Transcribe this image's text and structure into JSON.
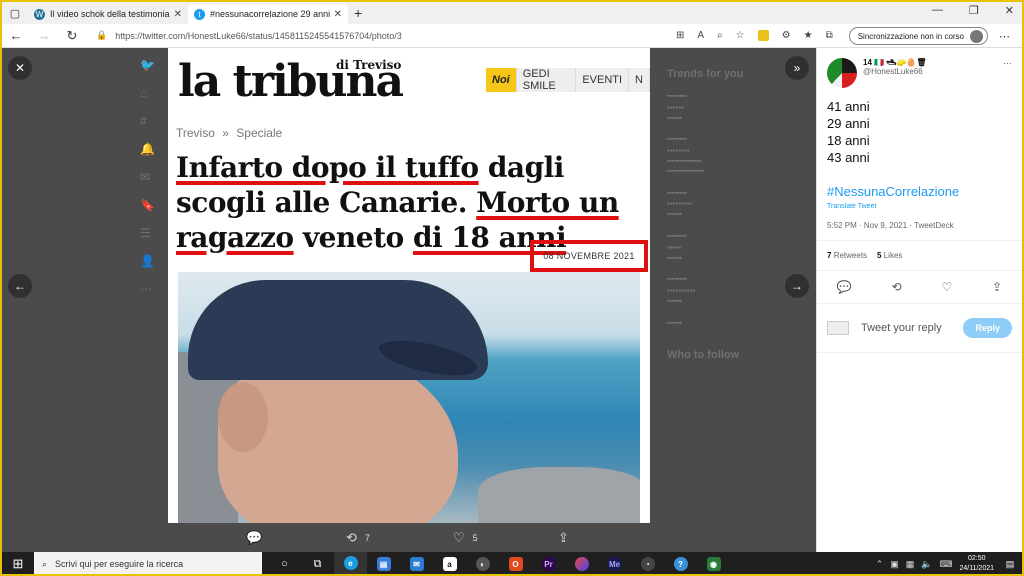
{
  "browser": {
    "tabs": [
      {
        "title": "Il video schok della testimonianz",
        "icon": "wordpress-icon"
      },
      {
        "title": "#nessunacorrelazione 29 anni - T",
        "icon": "twitter-icon"
      }
    ],
    "url": "https://twitter.com/HonestLuke66/status/1458115245541576704/photo/3",
    "sync_label": "Sincronizzazione non in corso"
  },
  "article": {
    "logo": "la tribuna",
    "logo_sub": "di Treviso",
    "nav": [
      "Noi",
      "GEDI SMILE",
      "EVENTI",
      "N"
    ],
    "breadcrumb_1": "Treviso",
    "breadcrumb_sep": "»",
    "breadcrumb_2": "Speciale",
    "headline_1": "Infarto dopo il tuffo",
    "headline_2": " dagli scogli alle Canarie. ",
    "headline_3": "Morto un ragazzo",
    "headline_4": " veneto ",
    "headline_5": "di 18 anni",
    "date": "08 NOVEMBRE 2021"
  },
  "viewer_actions": {
    "retweets": "7",
    "likes": "5"
  },
  "background_feed": {
    "trends_title": "Trends for you",
    "who_to_follow": "Who to follow"
  },
  "tweet": {
    "name": "14 🇮🇹 🛥🧽🥚🗑",
    "handle": "@HonestLuke66",
    "lines": [
      "41 anni",
      "29 anni",
      "18 anni",
      "43 anni"
    ],
    "hashtag": "#NessunaCorrelazione",
    "translate": "Translate Tweet",
    "meta": "5:52 PM · Nov 9, 2021 · TweetDeck",
    "retweets_count": "7",
    "retweets_label": "Retweets",
    "likes_count": "5",
    "likes_label": "Likes",
    "reply_placeholder": "Tweet your reply",
    "reply_button": "Reply"
  },
  "taskbar": {
    "search_placeholder": "Scrivi qui per eseguire la ricerca",
    "time": "02:50",
    "date": "24/11/2021"
  },
  "colors": {
    "accent": "#1d9bf0",
    "highlight_red": "#e01010",
    "nav_yellow": "#f5c518"
  }
}
